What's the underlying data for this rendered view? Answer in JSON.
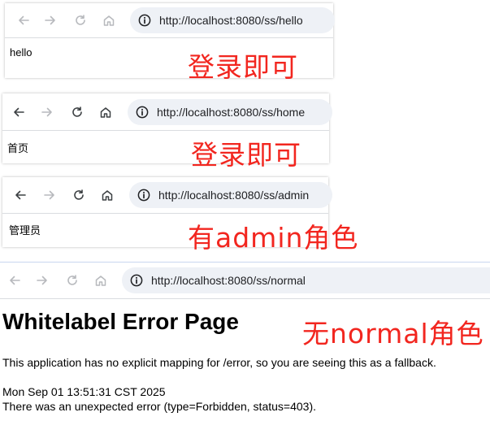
{
  "panels": [
    {
      "url": "http://localhost:8080/ss/hello",
      "body_text": "hello",
      "annotation": "登录即可"
    },
    {
      "url": "http://localhost:8080/ss/home",
      "body_text": "首页",
      "annotation": "登录即可"
    },
    {
      "url": "http://localhost:8080/ss/admin",
      "body_text": "管理员",
      "annotation": "有admin角色"
    },
    {
      "url": "http://localhost:8080/ss/normal",
      "error_title": "Whitelabel Error Page",
      "error_message": "This application has no explicit mapping for /error, so you are seeing this as a fallback.",
      "error_timestamp": "Mon Sep 01 13:51:31 CST 2025",
      "error_detail": "There was an unexpected error (type=Forbidden, status=403).",
      "annotation": "无normal角色"
    }
  ],
  "icons": {
    "back": "back-arrow-icon",
    "forward": "forward-arrow-icon",
    "reload": "reload-icon",
    "home": "home-icon",
    "site_info": "info-icon"
  },
  "colors": {
    "annotation": "#f2261f",
    "url_bar": "#eef1f6",
    "icon_active": "#3c4043",
    "icon_disabled": "#b7b9bd"
  }
}
